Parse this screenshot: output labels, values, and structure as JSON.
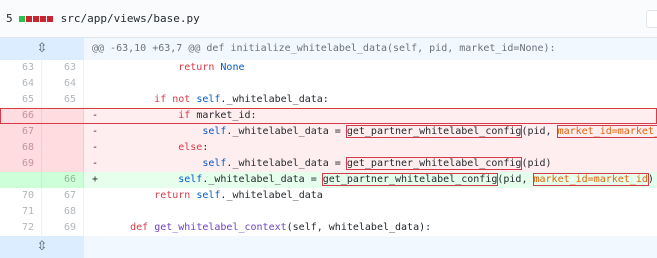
{
  "file": {
    "diff_count": "5",
    "path": "src/app/views/base.py",
    "diffstat": [
      "add",
      "del",
      "del",
      "del",
      "del"
    ]
  },
  "hunk": {
    "header": "@@ -63,10 +63,7 @@ def initialize_whitelabel_data(self, pid, market_id=None):",
    "expand_icon": "unfold-icon"
  },
  "lines": [
    {
      "old": "63",
      "new": "63",
      "type": "ctx",
      "indent": "            ",
      "parts": [
        [
          "kw",
          "return "
        ],
        [
          "self",
          "None"
        ]
      ]
    },
    {
      "old": "64",
      "new": "64",
      "type": "ctx",
      "indent": "",
      "parts": []
    },
    {
      "old": "65",
      "new": "65",
      "type": "ctx",
      "indent": "        ",
      "parts": [
        [
          "kw",
          "if not "
        ],
        [
          "self",
          "self"
        ],
        [
          "plain",
          "._whitelabel_data:"
        ]
      ]
    },
    {
      "old": "66",
      "new": "",
      "type": "del",
      "indent": "            ",
      "parts": [
        [
          "kw",
          "if "
        ],
        [
          "plain",
          "market_id:"
        ]
      ],
      "boxed": true
    },
    {
      "old": "67",
      "new": "",
      "type": "del",
      "indent": "                ",
      "parts": [
        [
          "self",
          "self"
        ],
        [
          "plain",
          "._whitelabel_data = "
        ],
        [
          "hlfn",
          "get_partner_whitelabel_config"
        ],
        [
          "plain",
          "(pid, "
        ],
        [
          "hlkw",
          "market_id=market_id"
        ],
        [
          "plain",
          ")"
        ]
      ]
    },
    {
      "old": "68",
      "new": "",
      "type": "del",
      "indent": "            ",
      "parts": [
        [
          "kw",
          "else"
        ],
        [
          "plain",
          ":"
        ]
      ]
    },
    {
      "old": "69",
      "new": "",
      "type": "del",
      "indent": "                ",
      "parts": [
        [
          "self",
          "self"
        ],
        [
          "plain",
          "._whitelabel_data = "
        ],
        [
          "hlfn",
          "get_partner_whitelabel_config"
        ],
        [
          "plain",
          "(pid)"
        ]
      ]
    },
    {
      "old": "",
      "new": "66",
      "type": "add",
      "indent": "            ",
      "parts": [
        [
          "self",
          "self"
        ],
        [
          "plain",
          "._whitelabel_data = "
        ],
        [
          "hlfn",
          "get_partner_whitelabel_config"
        ],
        [
          "plain",
          "(pid, "
        ],
        [
          "hlkw",
          "market_id=market_id"
        ],
        [
          "plain",
          ")"
        ]
      ]
    },
    {
      "old": "70",
      "new": "67",
      "type": "ctx",
      "indent": "        ",
      "parts": [
        [
          "kw",
          "return "
        ],
        [
          "self",
          "self"
        ],
        [
          "plain",
          "._whitelabel_data"
        ]
      ]
    },
    {
      "old": "71",
      "new": "68",
      "type": "ctx",
      "indent": "",
      "parts": []
    },
    {
      "old": "72",
      "new": "69",
      "type": "ctx",
      "indent": "    ",
      "parts": [
        [
          "kw",
          "def "
        ],
        [
          "fn",
          "get_whitelabel_context"
        ],
        [
          "plain",
          "(self, whitelabel_data):"
        ]
      ]
    }
  ],
  "colors": {
    "add_bar": "#2cbe4e",
    "del_bar": "#cb2431",
    "highlight_box": "#d73a49"
  }
}
